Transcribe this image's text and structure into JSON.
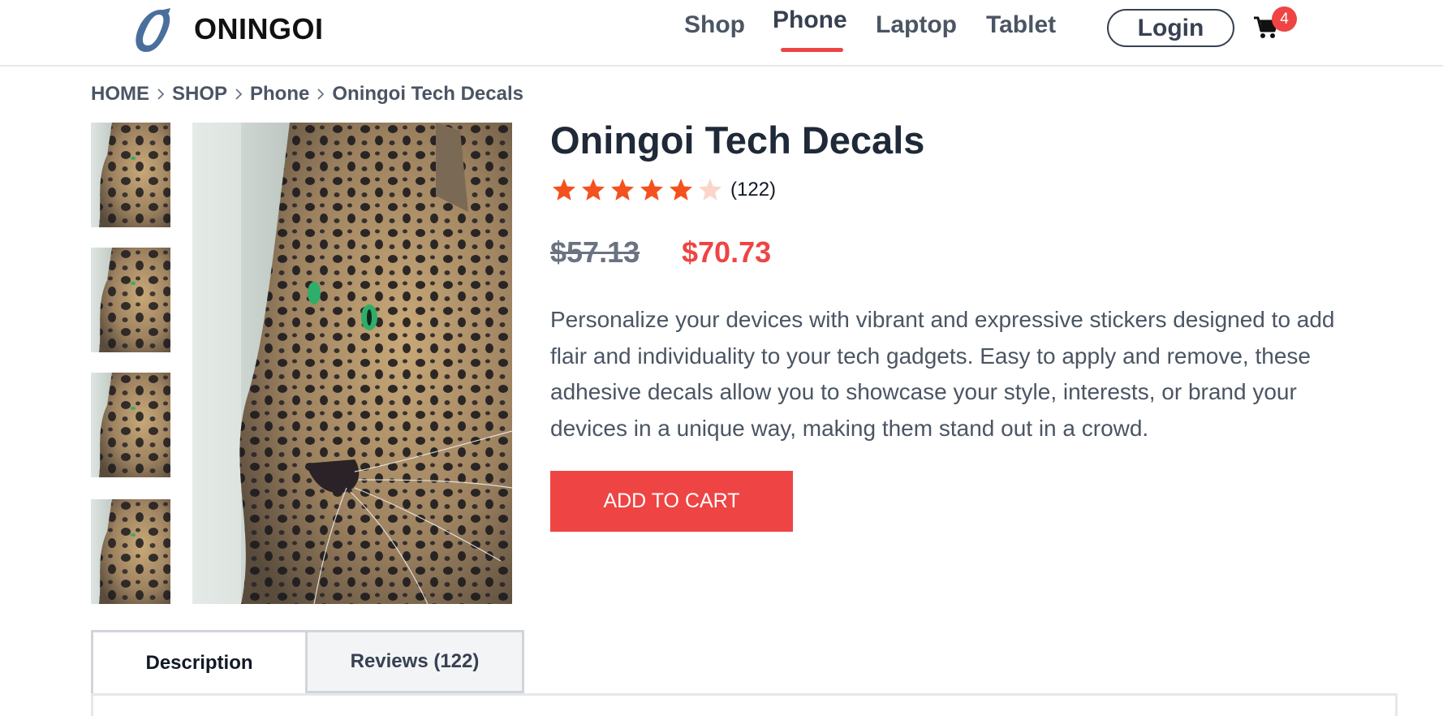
{
  "header": {
    "brand": "ONINGOI",
    "logo_letter": "O",
    "nav": [
      {
        "label": "Shop",
        "active": false
      },
      {
        "label": "Phone",
        "active": true
      },
      {
        "label": "Laptop",
        "active": false
      },
      {
        "label": "Tablet",
        "active": false
      }
    ],
    "login_label": "Login",
    "cart_count": "4",
    "cart_icon": "shopping-cart-icon"
  },
  "breadcrumb": {
    "items": [
      "HOME",
      "SHOP",
      "Phone",
      "Oningoi Tech Decals"
    ],
    "separator_icon": "chevron-right-icon"
  },
  "gallery": {
    "thumbnail_count": 4,
    "image_subject": "leopard"
  },
  "product": {
    "title": "Oningoi Tech Decals",
    "rating": 4,
    "rating_max": 5,
    "review_count": "(122)",
    "price_old": "$57.13",
    "price_new": "$70.73",
    "description": "Personalize your devices with vibrant and expressive stickers designed to add flair and individuality to your tech gadgets. Easy to apply and remove, these adhesive decals allow you to showcase your style, interests, or brand your devices in a unique way, making them stand out in a crowd.",
    "add_to_cart_label": "ADD TO CART"
  },
  "tabs": [
    {
      "label": "Description",
      "active": true
    },
    {
      "label": "Reviews (122)",
      "active": false
    }
  ],
  "colors": {
    "accent": "#ef4444",
    "star_filled": "#f4511e",
    "star_empty": "#fbd5c9",
    "logo": "#4a6f9c",
    "text_dark": "#1f2937"
  }
}
